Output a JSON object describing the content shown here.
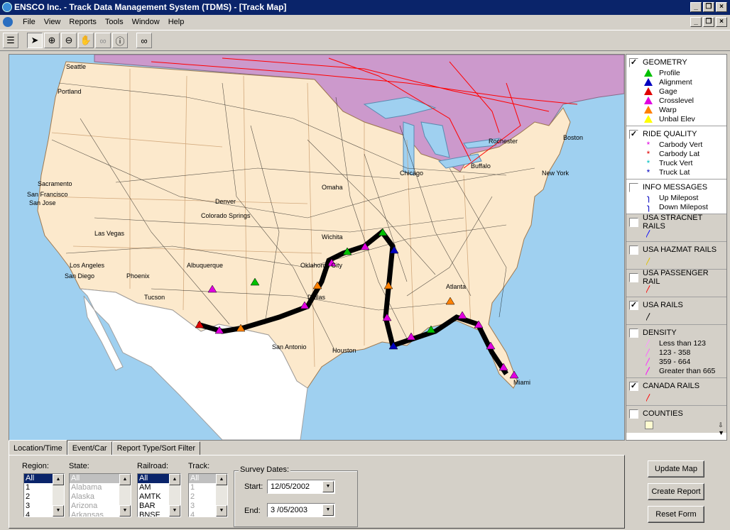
{
  "window": {
    "title": "ENSCO Inc. - Track Data Management System (TDMS) - [Track Map]"
  },
  "menu": [
    "File",
    "View",
    "Reports",
    "Tools",
    "Window",
    "Help"
  ],
  "toolbar": {
    "tools": [
      "layers-icon",
      "pointer-icon",
      "zoom-in-icon",
      "zoom-out-icon",
      "pan-hand-icon",
      "binoculars-disabled-icon",
      "info-icon",
      "binoculars-icon"
    ]
  },
  "map": {
    "cities": [
      "Seattle",
      "Portland",
      "Sacramento",
      "San Francisco",
      "San Jose",
      "Las Vegas",
      "Los Angeles",
      "San Diego",
      "Phoenix",
      "Tucson",
      "Albuquerque",
      "Denver",
      "Colorado Springs",
      "Oklahoma City",
      "Dallas",
      "San Antonio",
      "Houston",
      "Chicago",
      "Rochester",
      "Buffalo",
      "Boston",
      "New York",
      "Atlanta",
      "Miami",
      "Omaha",
      "Wichita"
    ]
  },
  "legend": {
    "geometry": {
      "label": "GEOMETRY",
      "checked": true,
      "items": [
        {
          "label": "Profile",
          "color": "#00c000"
        },
        {
          "label": "Alignment",
          "color": "#0000c0"
        },
        {
          "label": "Gage",
          "color": "#e00000"
        },
        {
          "label": "Crosslevel",
          "color": "#e000e0"
        },
        {
          "label": "Warp",
          "color": "#ff8000"
        },
        {
          "label": "Unbal Elev",
          "color": "#ffff00"
        }
      ]
    },
    "ride_quality": {
      "label": "RIDE QUALITY",
      "checked": true,
      "items": [
        {
          "label": "Carbody Vert",
          "color": "#e000e0"
        },
        {
          "label": "Carbody Lat",
          "color": "#e00000"
        },
        {
          "label": "Truck Vert",
          "color": "#00c0c0"
        },
        {
          "label": "Truck Lat",
          "color": "#0000c0"
        }
      ]
    },
    "info_messages": {
      "label": "INFO MESSAGES",
      "checked": false,
      "items": [
        {
          "label": "Up Milepost"
        },
        {
          "label": "Down Milepost"
        }
      ]
    },
    "stracnet": {
      "label": "USA STRACNET RAILS",
      "checked": false,
      "color": "#0000ff"
    },
    "hazmat": {
      "label": "USA HAZMAT RAILS",
      "checked": false,
      "color": "#e0c000"
    },
    "passenger": {
      "label": "USA PASSENGER RAIL",
      "checked": false,
      "color": "#ff0000"
    },
    "usa_rails": {
      "label": "USA RAILS",
      "checked": true,
      "color": "#000000"
    },
    "density": {
      "label": "DENSITY",
      "checked": false,
      "items": [
        {
          "label": "Less than 123"
        },
        {
          "label": "123 - 358"
        },
        {
          "label": "359 - 664"
        },
        {
          "label": "Greater than 665"
        }
      ]
    },
    "canada_rails": {
      "label": "CANADA RAILS",
      "checked": true,
      "color": "#ff0000"
    },
    "counties": {
      "label": "COUNTIES",
      "checked": false
    }
  },
  "tabs": [
    "Location/Time",
    "Event/Car",
    "Report Type/Sort Filter"
  ],
  "form": {
    "region": {
      "label": "Region:",
      "options": [
        "All",
        "1",
        "2",
        "3",
        "4"
      ]
    },
    "state": {
      "label": "State:",
      "options": [
        "All",
        "Alabama",
        "Alaska",
        "Arizona",
        "Arkansas"
      ]
    },
    "railroad": {
      "label": "Railroad:",
      "options": [
        "All",
        "AM",
        "AMTK",
        "BAR",
        "BNSF"
      ]
    },
    "track": {
      "label": "Track:",
      "options": [
        "All",
        "1",
        "2",
        "3",
        "4"
      ]
    },
    "survey": {
      "title": "Survey Dates:",
      "start_label": "Start:",
      "start": "12/05/2002",
      "end_label": "End:",
      "end": " 3 /05/2003"
    }
  },
  "buttons": {
    "update": "Update Map",
    "create": "Create Report",
    "reset": "Reset Form"
  }
}
